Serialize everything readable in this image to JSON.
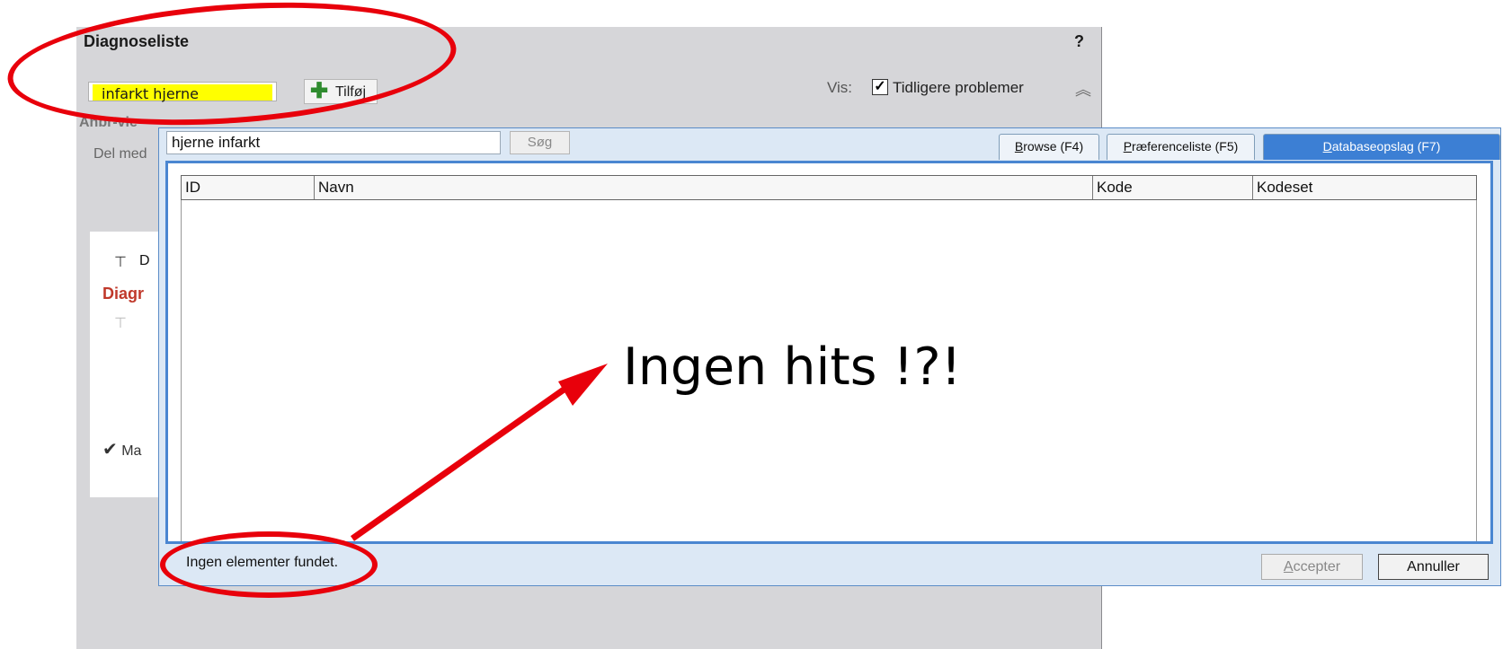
{
  "background": {
    "title": "Diagnoseliste",
    "help": "?",
    "search_value": "infarkt hjerne",
    "add_button_label": "Tilføj",
    "vis_label": "Vis:",
    "vis_option": "Tidligere problemer",
    "vis_checked": true,
    "partial_row_label": "Anbr-vie",
    "partial_share_label": "Del med",
    "partial_card_letter": "D",
    "partial_card_title": "Diagr",
    "partial_confirm_label": "Ma"
  },
  "dialog": {
    "search_value": "hjerne infarkt",
    "search_button": "Søg",
    "tabs": [
      {
        "label_accel": "B",
        "label_rest": "rowse (F4)",
        "active": false
      },
      {
        "label_accel": "P",
        "label_rest": "ræferenceliste (F5)",
        "active": true
      },
      {
        "label_accel": "D",
        "label_rest": "atabaseopslag (F7)",
        "active": true
      }
    ],
    "columns": [
      "ID",
      "Navn",
      "Kode",
      "Kodeset"
    ],
    "rows": [],
    "status": "Ingen elementer fundet.",
    "accept_accel": "A",
    "accept_rest": "ccepter",
    "cancel_label": "Annuller"
  },
  "annotation": {
    "text": "Ingen hits !?!",
    "color": "#e8000b"
  }
}
